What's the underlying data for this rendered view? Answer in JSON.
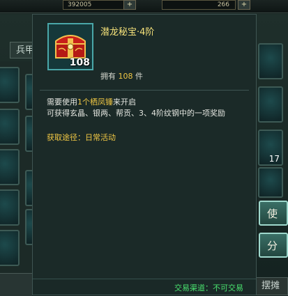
{
  "topbar": {
    "currency_1": "392005",
    "currency_2": "266",
    "plus_label": "+"
  },
  "background": {
    "tab_label": "兵甲",
    "slot_count_label": "17",
    "use_button_label": "使用",
    "share_button_label": "分享",
    "bottom_tab_label": "摆摊"
  },
  "tooltip": {
    "item_name": "潜龙秘宝·4阶",
    "item_count": "108",
    "owned_prefix": "拥有",
    "owned_count": "108",
    "owned_suffix": "件",
    "desc_line1_prefix": "需要使用",
    "desc_line1_highlight": "1个栖凤锤",
    "desc_line1_suffix": "来开启",
    "desc_line2": "可获得玄晶、银两、帮贡、3、4阶纹钢中的一项奖励",
    "source_label": "获取途径：日常活动",
    "trade_label": "交易渠道：不可交易"
  }
}
